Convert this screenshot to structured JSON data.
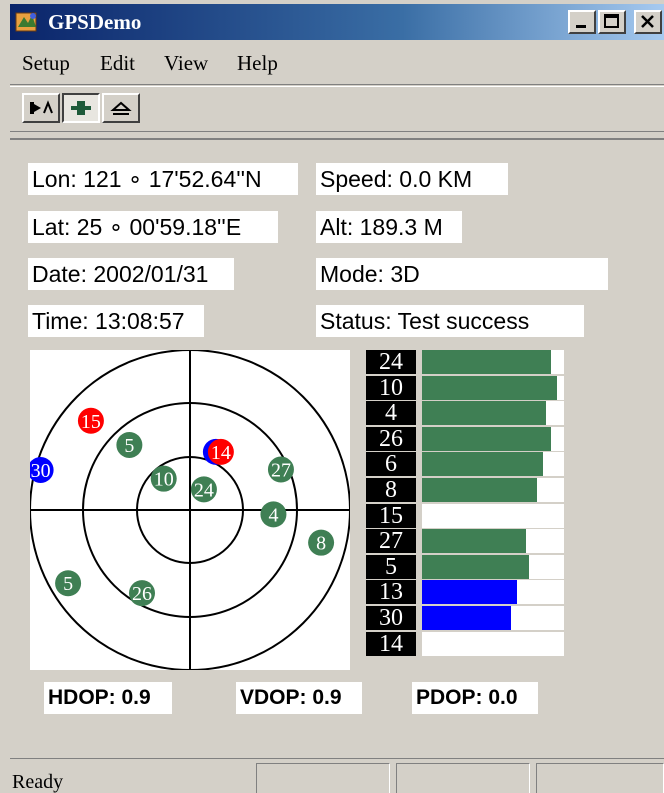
{
  "window": {
    "title": "GPSDemo"
  },
  "menu": [
    "Setup",
    "Edit",
    "View",
    "Help"
  ],
  "info": {
    "lon": "Lon: 121 ∘ 17'52.64''N",
    "lat": "Lat: 25 ∘ 00'59.18''E",
    "date": "Date: 2002/01/31",
    "time": "Time: 13:08:57",
    "speed": "Speed:  0.0 KM",
    "alt": "Alt: 189.3 M",
    "mode": "Mode: 3D",
    "status": "Status: Test success"
  },
  "colors": {
    "green": "#3f7f54",
    "red": "#ff0000",
    "blue": "#0000ff"
  },
  "satellites": [
    {
      "prn": "14",
      "elevation": 53,
      "azimuth": 28,
      "color": "red",
      "ring": "blue"
    },
    {
      "prn": "5",
      "elevation": 40,
      "azimuth": 317,
      "color": "green"
    },
    {
      "prn": "15",
      "elevation": 15,
      "azimuth": 312,
      "color": "red"
    },
    {
      "prn": "27",
      "elevation": 34,
      "azimuth": 66,
      "color": "green"
    },
    {
      "prn": "10",
      "elevation": 67,
      "azimuth": 320,
      "color": "green"
    },
    {
      "prn": "24",
      "elevation": 76,
      "azimuth": 34,
      "color": "green"
    },
    {
      "prn": "4",
      "elevation": 43,
      "azimuth": 93,
      "color": "green"
    },
    {
      "prn": "8",
      "elevation": 14,
      "azimuth": 104,
      "color": "green"
    },
    {
      "prn": "30",
      "elevation": 3,
      "azimuth": 285,
      "color": "blue"
    },
    {
      "prn": "5",
      "elevation": 10,
      "azimuth": 239,
      "color": "green"
    },
    {
      "prn": "26",
      "elevation": 36,
      "azimuth": 210,
      "color": "green"
    }
  ],
  "signals": [
    {
      "prn": "24",
      "level": 0.91,
      "color": "green"
    },
    {
      "prn": "10",
      "level": 0.95,
      "color": "green"
    },
    {
      "prn": "4",
      "level": 0.87,
      "color": "green"
    },
    {
      "prn": "26",
      "level": 0.91,
      "color": "green"
    },
    {
      "prn": "6",
      "level": 0.85,
      "color": "green"
    },
    {
      "prn": "8",
      "level": 0.81,
      "color": "green"
    },
    {
      "prn": "15",
      "level": 0,
      "color": "green"
    },
    {
      "prn": "27",
      "level": 0.73,
      "color": "green"
    },
    {
      "prn": "5",
      "level": 0.75,
      "color": "green"
    },
    {
      "prn": "13",
      "level": 0.67,
      "color": "blue"
    },
    {
      "prn": "30",
      "level": 0.63,
      "color": "blue"
    },
    {
      "prn": "14",
      "level": 0,
      "color": "green"
    }
  ],
  "dop": {
    "hdop": "HDOP: 0.9",
    "vdop": "VDOP: 0.9",
    "pdop": "PDOP: 0.0"
  },
  "statusbar": {
    "text": "Ready"
  }
}
